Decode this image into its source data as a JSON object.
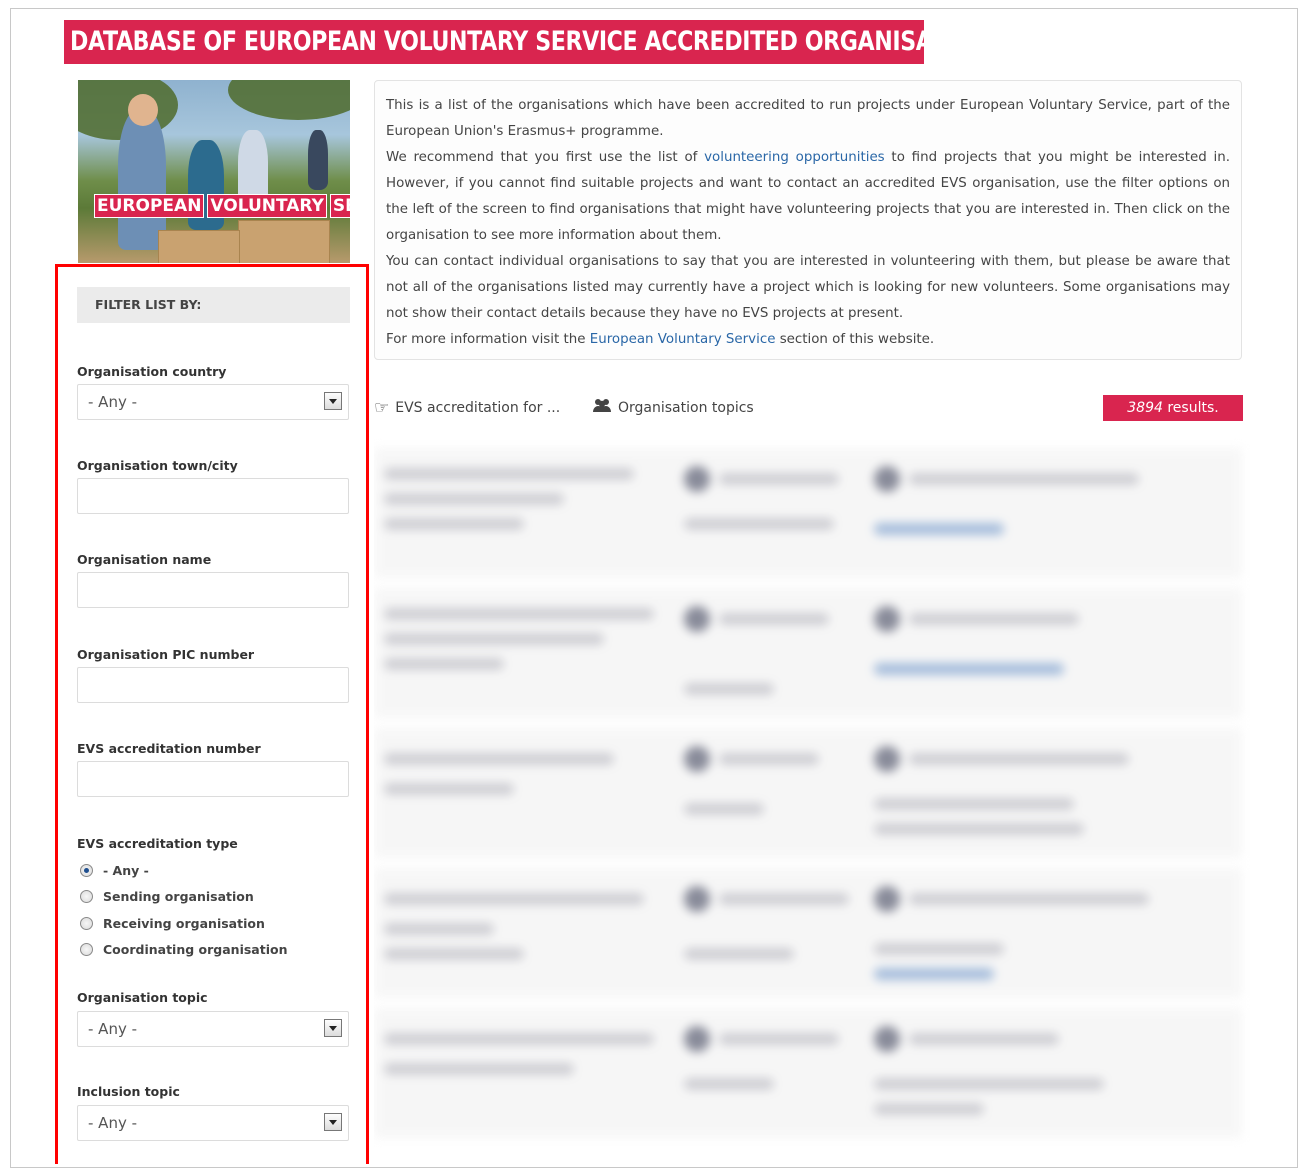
{
  "page": {
    "title": "DATABASE OF EUROPEAN VOLUNTARY SERVICE ACCREDITED ORGANISATIONS"
  },
  "hero": {
    "label_words": [
      "EUROPEAN",
      "VOLUNTARY",
      "SERVICE"
    ],
    "brand_color": "#d9254f"
  },
  "intro": {
    "p1": "This is a list of the organisations which have been accredited to run projects under European Voluntary Service, part of the European Union's Erasmus+ programme.",
    "p2_before": "We recommend that you first use the list of ",
    "p2_link": "volunteering opportunities",
    "p2_after": " to find projects that you might be interested in. However, if you cannot find suitable projects and want to contact an accredited EVS organisation, use the filter options on the left of the screen to find organisations that might have volunteering projects that you are interested in. Then click on the organisation to see more information about them.",
    "p3": "You can contact individual organisations to say that you are interested in volunteering with them, but please be aware that not all of the organisations listed may currently have a project which is looking for new volunteers. Some organisations may not show their contact details because they have no EVS projects at present.",
    "p4_before": "For more information visit the ",
    "p4_link": "European Voluntary Service",
    "p4_after": " section of this website."
  },
  "filter": {
    "header": "FILTER LIST BY:",
    "country_label": "Organisation country",
    "country_value": "- Any -",
    "town_label": "Organisation town/city",
    "name_label": "Organisation name",
    "pic_label": "Organisation PIC number",
    "accr_number_label": "EVS accreditation number",
    "accr_type_label": "EVS accreditation type",
    "accr_type_options": [
      "- Any -",
      "Sending organisation",
      "Receiving organisation",
      "Coordinating organisation"
    ],
    "accr_type_selected": "- Any -",
    "topic_label": "Organisation topic",
    "topic_value": "- Any -",
    "inclusion_label": "Inclusion topic",
    "inclusion_value": "- Any -",
    "highlight_color": "#ff0000"
  },
  "tabs": {
    "accreditation": {
      "label": "EVS accreditation for ...",
      "icon": "hand-pointing-icon"
    },
    "topics": {
      "label": "Organisation topics",
      "icon": "users-icon"
    }
  },
  "results": {
    "count": "3894",
    "suffix": " results."
  }
}
